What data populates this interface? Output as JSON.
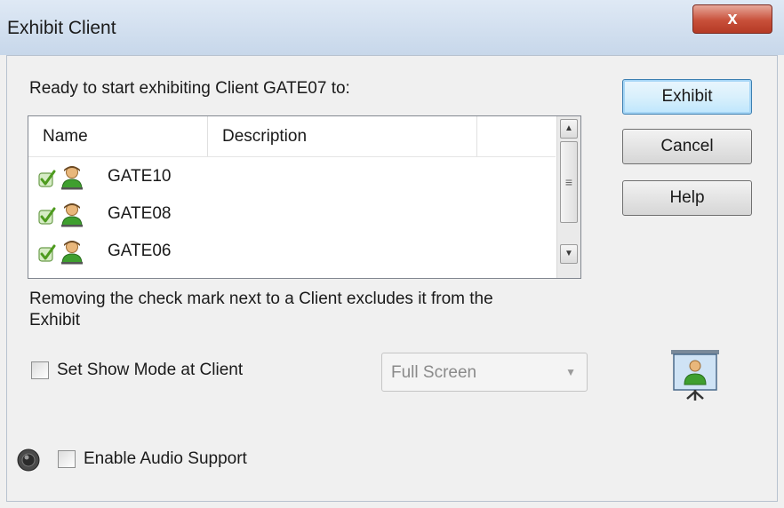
{
  "window": {
    "title": "Exhibit Client",
    "close_label": "x"
  },
  "prompt_text": "Ready to start exhibiting Client GATE07 to:",
  "buttons": {
    "exhibit": "Exhibit",
    "cancel": "Cancel",
    "help": "Help"
  },
  "client_list": {
    "columns": [
      "Name",
      "Description"
    ],
    "rows": [
      {
        "name": "GATE10",
        "description": "",
        "checked": true
      },
      {
        "name": "GATE08",
        "description": "",
        "checked": true
      },
      {
        "name": "GATE06",
        "description": "",
        "checked": true
      }
    ],
    "scrollbar": {
      "up_glyph": "▲",
      "down_glyph": "▼",
      "thumb_glyph": "≡"
    }
  },
  "note_line1": "Removing the check mark next to a Client excludes it from the",
  "note_line2": "Exhibit",
  "show_mode": {
    "label": "Set Show Mode at Client",
    "checked": false,
    "selected": "Full Screen",
    "arrow": "▼"
  },
  "audio": {
    "label": "Enable Audio Support",
    "checked": false
  },
  "icons": {
    "row_check": "green-check-icon",
    "row_user": "user-icon",
    "show_mode": "projector-icon",
    "audio": "speaker-icon"
  },
  "colors": {
    "accent_green": "#6bb535",
    "title_bar": "#c7d7ea",
    "close_red": "#c8503a"
  }
}
